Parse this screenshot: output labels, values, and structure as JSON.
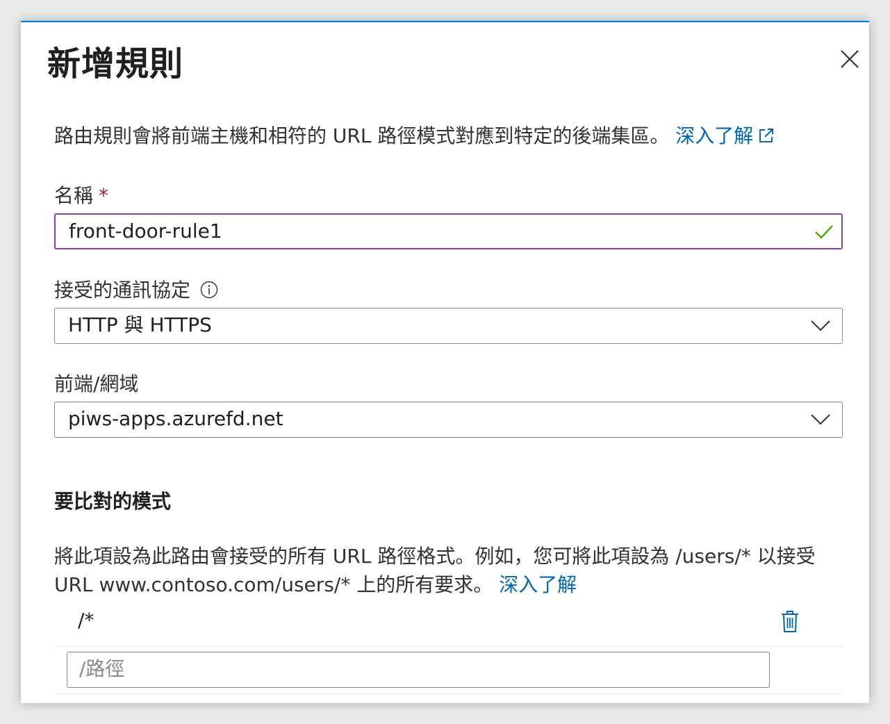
{
  "dialog": {
    "title": "新增規則",
    "accent_color": "#0078d4"
  },
  "description": {
    "text": "路由規則會將前端主機和相符的 URL 路徑模式對應到特定的後端集區。",
    "link": "深入了解"
  },
  "name_field": {
    "label": "名稱",
    "required_mark": "*",
    "value": "front-door-rule1",
    "status": "valid"
  },
  "protocol_field": {
    "label": "接受的通訊協定",
    "info_icon": "info-icon",
    "value": "HTTP 與 HTTPS"
  },
  "frontend_field": {
    "label": "前端/網域",
    "value": "piws-apps.azurefd.net"
  },
  "patterns": {
    "title": "要比對的模式",
    "description": "將此項設為此路由會接受的所有 URL 路徑格式。例如，您可將此項設為 /users/* 以接受 URL www.contoso.com/users/* 上的所有要求。",
    "link": "深入了解",
    "items": [
      "/*"
    ],
    "new_path_placeholder": "/路徑"
  }
}
